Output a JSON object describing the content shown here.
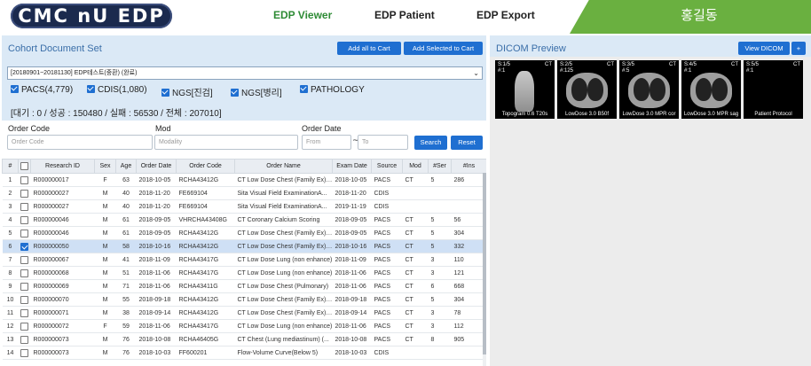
{
  "header": {
    "logo_text": "CMC nU EDP",
    "nav": [
      "EDP Viewer",
      "EDP Patient",
      "EDP Export"
    ],
    "active_nav": "EDP Viewer",
    "user_name": "홍길동"
  },
  "cohort": {
    "title": "Cohort Document Set",
    "btn_add_all": "Add all to Cart",
    "btn_add_selected": "Add Selected to Cart",
    "selected_set": "[20180901~20181130] EDP테스트(중환) (완료)",
    "sources": [
      {
        "label": "PACS(4,779)",
        "checked": true
      },
      {
        "label": "CDIS(1,080)",
        "checked": true
      },
      {
        "label": "NGS[진검]",
        "checked": true
      },
      {
        "label": "NGS[병리]",
        "checked": true
      },
      {
        "label": "PATHOLOGY",
        "checked": true
      }
    ],
    "stats": "[대기 : 0 / 성공 : 150480 / 실패 : 56530 / 전체 : 207010]"
  },
  "filters": {
    "order_code_label": "Order Code",
    "order_code_placeholder": "Order Code",
    "mod_label": "Mod",
    "mod_placeholder": "Modality",
    "order_date_label": "Order Date",
    "from_placeholder": "From",
    "tilde": "~",
    "to_placeholder": "To",
    "search_label": "Search",
    "reset_label": "Reset"
  },
  "table": {
    "columns": [
      "#",
      "",
      "Research ID",
      "Sex",
      "Age",
      "Order Date",
      "Order Code",
      "Order Name",
      "Exam Date",
      "Source",
      "Mod",
      "#Ser",
      "#Ins"
    ],
    "rows": [
      [
        "1",
        "R000000017",
        "F",
        "63",
        "2018-10-05",
        "RCHA43412G",
        "CT Low Dose Chest (Family Ex) ...",
        "2018-10-05",
        "PACS",
        "CT",
        "5",
        "286"
      ],
      [
        "2",
        "R000000027",
        "M",
        "40",
        "2018-11-20",
        "FE669104",
        "Sita Visual Field ExaminationA...",
        "2018-11-20",
        "CDIS",
        "",
        "",
        ""
      ],
      [
        "3",
        "R000000027",
        "M",
        "40",
        "2018-11-20",
        "FE669104",
        "Sita Visual Field ExaminationA...",
        "2019-11-19",
        "CDIS",
        "",
        "",
        ""
      ],
      [
        "4",
        "R000000046",
        "M",
        "61",
        "2018-09-05",
        "VHRCHA43408G",
        "CT Coronary Calcium Scoring",
        "2018-09-05",
        "PACS",
        "CT",
        "5",
        "56"
      ],
      [
        "5",
        "R000000046",
        "M",
        "61",
        "2018-09-05",
        "RCHA43412G",
        "CT Low Dose Chest (Family Ex) ...",
        "2018-09-05",
        "PACS",
        "CT",
        "5",
        "304"
      ],
      [
        "6",
        "R000000050",
        "M",
        "58",
        "2018-10-16",
        "RCHA43412G",
        "CT Low Dose Chest (Family Ex) ...",
        "2018-10-16",
        "PACS",
        "CT",
        "5",
        "332"
      ],
      [
        "7",
        "R000000067",
        "M",
        "41",
        "2018-11-09",
        "RCHA43417G",
        "CT Low Dose Lung (non enhance)",
        "2018-11-09",
        "PACS",
        "CT",
        "3",
        "110"
      ],
      [
        "8",
        "R000000068",
        "M",
        "51",
        "2018-11-06",
        "RCHA43417G",
        "CT Low Dose Lung (non enhance)",
        "2018-11-06",
        "PACS",
        "CT",
        "3",
        "121"
      ],
      [
        "9",
        "R000000069",
        "M",
        "71",
        "2018-11-06",
        "RCHA43411G",
        "CT Low Dose Chest (Pulmonary)",
        "2018-11-06",
        "PACS",
        "CT",
        "6",
        "668"
      ],
      [
        "10",
        "R000000070",
        "M",
        "55",
        "2018-09-18",
        "RCHA43412G",
        "CT Low Dose Chest (Family Ex) ...",
        "2018-09-18",
        "PACS",
        "CT",
        "5",
        "304"
      ],
      [
        "11",
        "R000000071",
        "M",
        "38",
        "2018-09-14",
        "RCHA43412G",
        "CT Low Dose Chest (Family Ex) ...",
        "2018-09-14",
        "PACS",
        "CT",
        "3",
        "78"
      ],
      [
        "12",
        "R000000072",
        "F",
        "59",
        "2018-11-06",
        "RCHA43417G",
        "CT Low Dose Lung (non enhance)",
        "2018-11-06",
        "PACS",
        "CT",
        "3",
        "112"
      ],
      [
        "13",
        "R000000073",
        "M",
        "76",
        "2018-10-08",
        "RCHA46405G",
        "CT Chest (Lung mediastinum) (...",
        "2018-10-08",
        "PACS",
        "CT",
        "8",
        "905"
      ],
      [
        "14",
        "R000000073",
        "M",
        "76",
        "2018-10-03",
        "FF600201",
        "Flow-Volume Curve(Below 5)",
        "2018-10-03",
        "CDIS",
        "",
        "",
        ""
      ]
    ],
    "selected_row": "6"
  },
  "dicom": {
    "title": "DICOM Preview",
    "btn_view": "View DICOM",
    "btn_plus": "+",
    "thumbnails": [
      {
        "series": "S:1/5",
        "instance": "#:1",
        "mod": "CT",
        "caption": "Topogram 0.6 T20s"
      },
      {
        "series": "S:2/5",
        "instance": "#:125",
        "mod": "CT",
        "caption": "LowDose 3.0 B50f"
      },
      {
        "series": "S:3/5",
        "instance": "#:5",
        "mod": "CT",
        "caption": "LowDose 3.0 MPR cor"
      },
      {
        "series": "S:4/5",
        "instance": "#:1",
        "mod": "CT",
        "caption": "LowDose 3.0 MPR sag"
      },
      {
        "series": "S:5/5",
        "instance": "#:1",
        "mod": "CT",
        "caption": "Patient Protocol"
      }
    ]
  }
}
